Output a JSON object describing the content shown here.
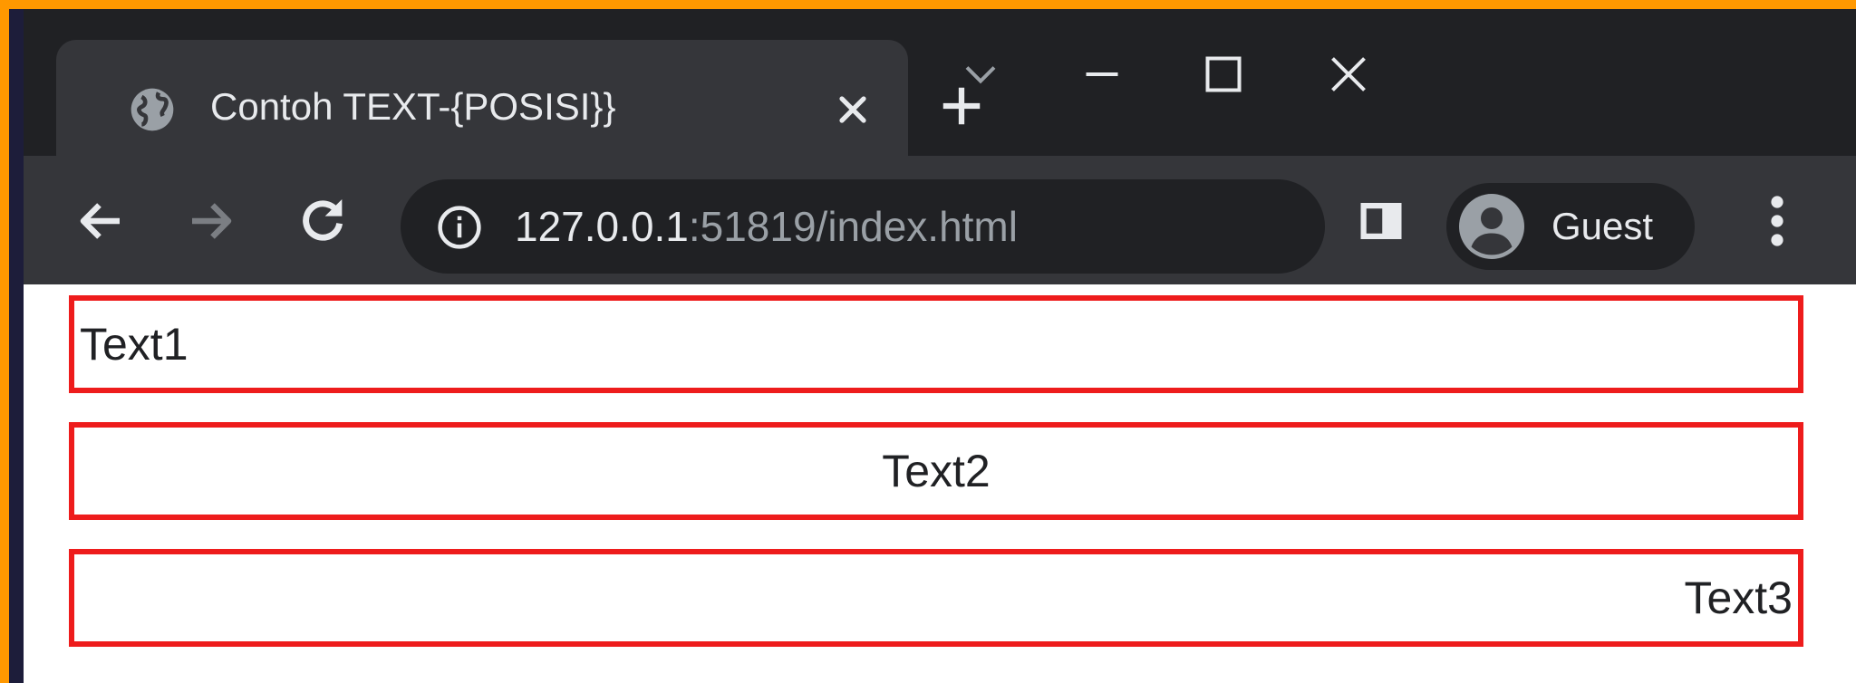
{
  "browser": {
    "tab": {
      "title": "Contoh TEXT-{POSISI}}",
      "favicon": "globe-icon"
    },
    "address_bar": {
      "host": "127.0.0.1",
      "rest": ":51819/index.html"
    },
    "profile": {
      "label": "Guest"
    }
  },
  "page": {
    "boxes": [
      {
        "text": "Text1",
        "align": "left"
      },
      {
        "text": "Text2",
        "align": "center"
      },
      {
        "text": "Text3",
        "align": "right"
      }
    ],
    "border_color": "#ee1c1c"
  },
  "colors": {
    "frame": "#ff9800",
    "titlebar": "#202124",
    "toolbar": "#35363a"
  }
}
